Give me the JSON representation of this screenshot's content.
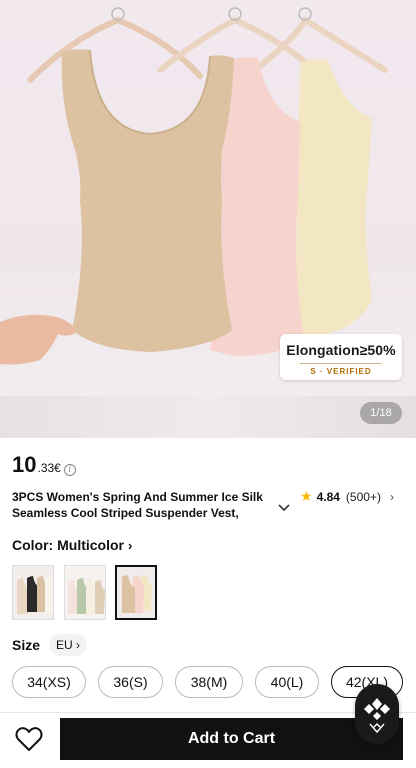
{
  "hero": {
    "badge_main": "Elongation≥50%",
    "badge_sub": "S · VERIFIED",
    "counter": "1/18"
  },
  "price": {
    "integer": "10",
    "decimal": ".33€",
    "info_icon": "info-icon"
  },
  "product": {
    "title": "3PCS Women's Spring And Summer Ice Silk Seamless Cool Striped Suspender Vest,",
    "expand_icon": "chevron-down-icon"
  },
  "rating": {
    "score": "4.84",
    "count": "(500+)",
    "star_color": "#f6b900"
  },
  "color": {
    "label": "Color: Multicolor",
    "swatches": [
      "multicolor-a",
      "multicolor-b",
      "multicolor-c"
    ],
    "selected_index": 2
  },
  "size": {
    "label": "Size",
    "unit": "EU",
    "options": [
      "34(XS)",
      "36(S)",
      "38(M)",
      "40(L)",
      "42(XL)"
    ],
    "selected": "42(XL)"
  },
  "actions": {
    "add_to_cart": "Add to Cart",
    "wishlist_icon": "heart-icon"
  }
}
